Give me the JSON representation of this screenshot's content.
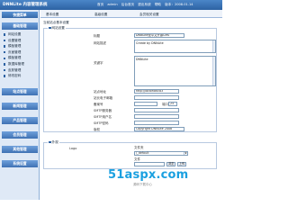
{
  "topbar": {
    "logo": "DNNLite 内容管理系统",
    "nav": [
      "首页",
      "admin",
      "后台首页",
      "退出系统",
      "帮助",
      "版本：2008.01.14"
    ]
  },
  "sidebar": {
    "head": "快捷菜单",
    "groups": [
      "基础管理",
      "站点管理",
      "新闻管理",
      "产品管理",
      "会员管理",
      "其他管理",
      "系统设置"
    ],
    "items": [
      "网站设置",
      "设置管理",
      "模板管理",
      "页面管理",
      "模板管理",
      "数据库管理",
      "皮肤管理",
      "修改密码"
    ]
  },
  "main": {
    "tabs": [
      "基本设置",
      "高级设置",
      "会员相关设置"
    ],
    "heading": "当前站点基本设置",
    "section_title": "网站设置",
    "fields": {
      "title_label": "标题",
      "title_value": "DNNLite是中文开源CMS",
      "desc_label": "网站描述",
      "desc_value": "Create by DNNLite",
      "keywords_label": "关键字",
      "keywords_value": "DNNLite",
      "url_label": "站点地址",
      "url_value": "http://localhost:83",
      "email_label": "站长电子邮箱",
      "icp_label": "备案号",
      "port_label": "端口",
      "port_value": "25",
      "smtp_label": "SMTP服务器",
      "smtp_user_label": "SMTP用户名",
      "smtp_pass_label": "SMTP密码",
      "copyright_label": "版权",
      "copyright_value": "Copyright DNNLite 2008"
    },
    "upload": {
      "section_title": "外观",
      "logo_label": "Logo",
      "file_label": "文件夹",
      "file_value": "/_default",
      "file_field_label": "文件",
      "browse_label": "浏览",
      "upload_label": "上传"
    }
  },
  "watermark": {
    "main": "51aspx.com",
    "sub": "源码下载中心"
  },
  "colors": {
    "topbar": "#2d62a3",
    "sidebar_bg": "#dfe9f6",
    "watermark": "#1aa0e0"
  }
}
